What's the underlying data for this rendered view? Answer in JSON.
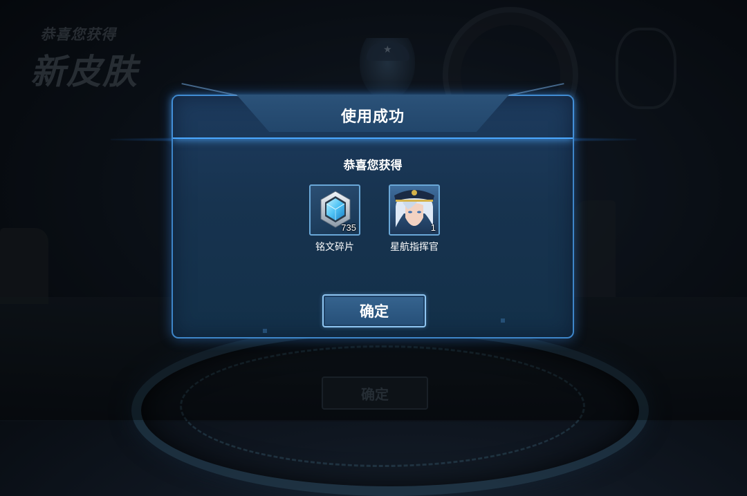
{
  "background": {
    "heading_small": "恭喜您获得",
    "heading_big": "新皮肤",
    "confirm_label": "确定"
  },
  "dialog": {
    "title": "使用成功",
    "subtitle": "恭喜您获得",
    "rewards": [
      {
        "name": "铭文碎片",
        "count": "735",
        "icon": "crystal-fragment-icon"
      },
      {
        "name": "星航指挥官",
        "count": "1",
        "icon": "hero-skin-portrait-icon"
      }
    ],
    "confirm_label": "确定"
  },
  "colors": {
    "accent_glow": "#4aa8ff",
    "dialog_bg": "#17334f",
    "button_border": "#8fc6f2"
  }
}
